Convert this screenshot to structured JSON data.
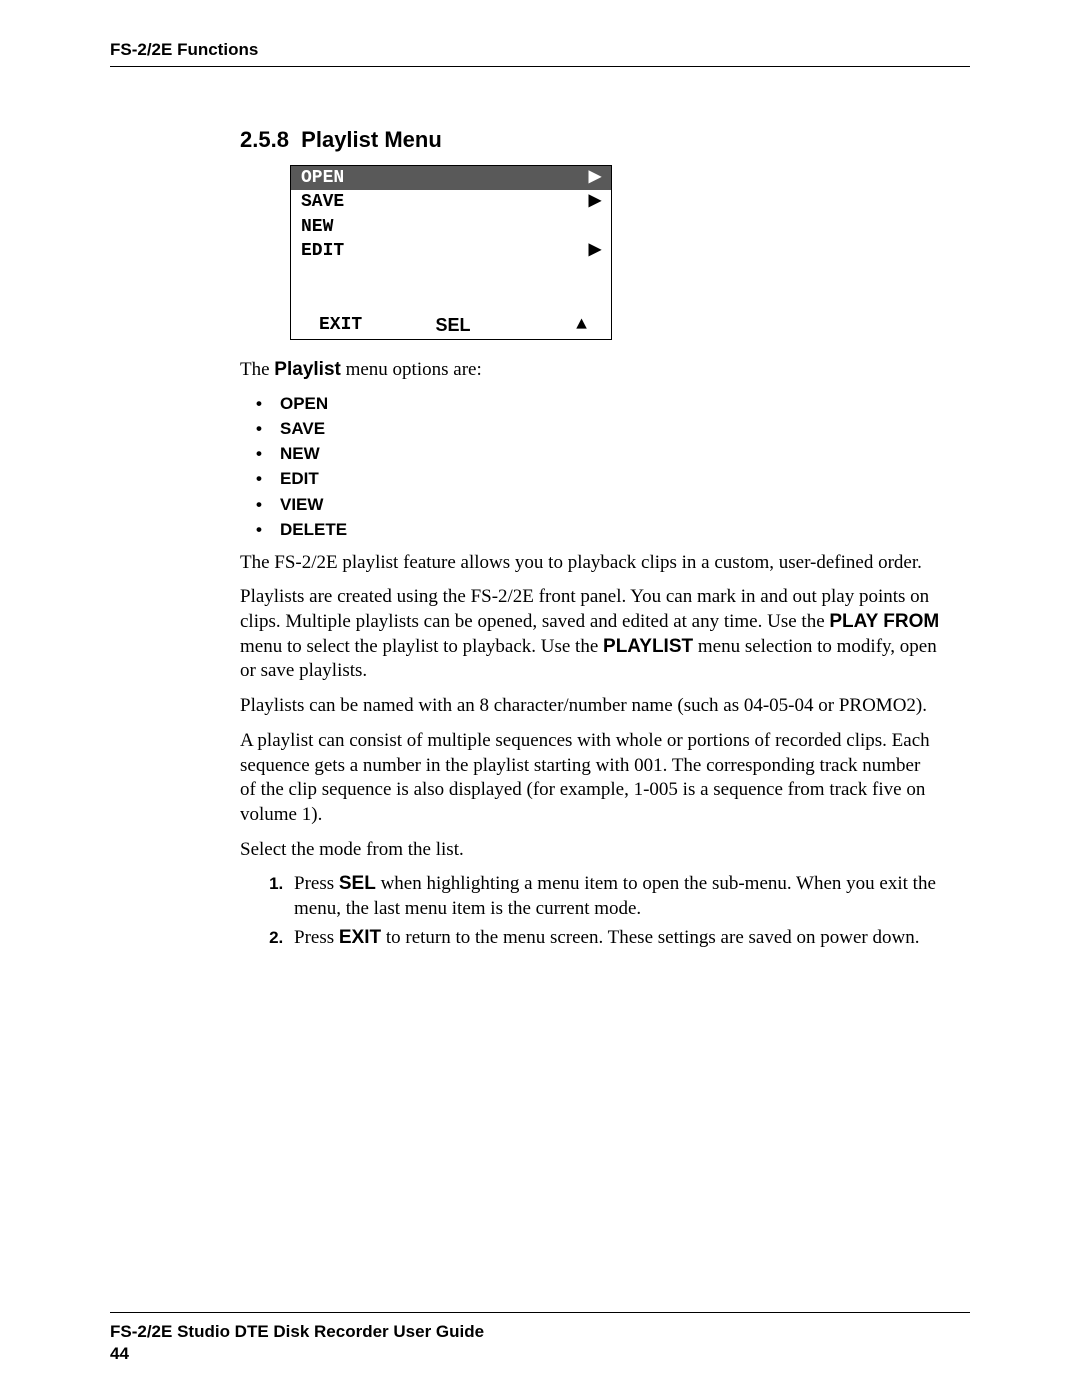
{
  "header": {
    "title": "FS-2/2E Functions"
  },
  "section": {
    "number": "2.5.8",
    "title": "Playlist Menu"
  },
  "menu": {
    "items": [
      {
        "label": "OPEN",
        "arrow": true,
        "selected": true
      },
      {
        "label": "SAVE",
        "arrow": true,
        "selected": false
      },
      {
        "label": "NEW",
        "arrow": false,
        "selected": false
      },
      {
        "label": "EDIT",
        "arrow": true,
        "selected": false
      }
    ],
    "footer": {
      "left": "EXIT",
      "mid": "SEL",
      "right": "▲"
    }
  },
  "intro_line_prefix": "The ",
  "intro_line_bold": "Playlist",
  "intro_line_suffix": " menu options are:",
  "bullets": [
    "OPEN",
    "SAVE",
    "NEW",
    "EDIT",
    "VIEW",
    "DELETE"
  ],
  "para1": "The FS-2/2E playlist feature allows you to playback clips in a custom, user-defined order.",
  "para2_a": "Playlists are created using the FS-2/2E front panel. You can mark in and out play points on clips. Multiple playlists can be opened, saved and edited at any time. Use the ",
  "para2_b": "PLAY FROM",
  "para2_c": " menu to select the playlist to playback. Use the ",
  "para2_d": "PLAYLIST",
  "para2_e": " menu selection to modify, open or save playlists.",
  "para3": "Playlists can be named with an 8 character/number name (such as 04-05-04 or PROMO2).",
  "para4": "A playlist can consist of multiple sequences with whole or portions of recorded clips. Each sequence gets a number in the playlist starting with 001. The corresponding track number of the clip sequence is also displayed (for example, 1-005 is a sequence from track five on volume 1).",
  "para5": "Select the mode from the list.",
  "steps": {
    "s1_a": "Press ",
    "s1_b": "SEL",
    "s1_c": " when highlighting a menu item to open the sub-menu. When you exit the menu, the last menu item is the current mode.",
    "s2_a": "Press ",
    "s2_b": "EXIT",
    "s2_c": " to return to the menu screen. These settings are saved on power down."
  },
  "footer": {
    "title": "FS-2/2E Studio DTE Disk Recorder User Guide",
    "page": "44"
  }
}
